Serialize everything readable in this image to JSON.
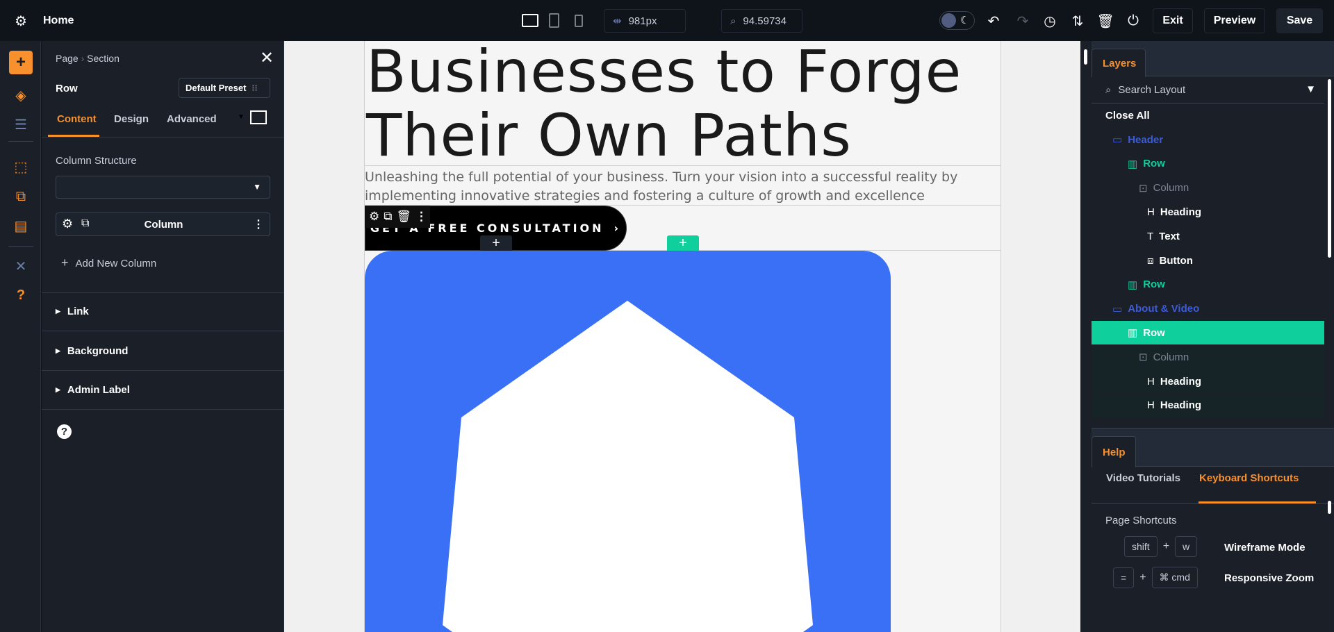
{
  "topbar": {
    "title": "Home",
    "width_value": "981px",
    "zoom_value": "94.59734",
    "exit": "Exit",
    "preview": "Preview",
    "save": "Save",
    "icons": [
      "gear-icon",
      "desktop-icon",
      "tablet-icon",
      "phone-icon",
      "width-icon",
      "zoom-icon",
      "dark-mode-toggle",
      "undo-icon",
      "redo-icon",
      "history-icon",
      "sort-icon",
      "trash-icon",
      "power-icon"
    ]
  },
  "rail": {
    "icons": [
      "add-icon",
      "layers-icon",
      "layout-icon",
      "select-icon",
      "multi-select-icon",
      "template-icon",
      "tools-icon",
      "help-icon"
    ],
    "accent": "#f7902d"
  },
  "settings": {
    "breadcrumb": [
      "Page",
      "Section"
    ],
    "title": "Row",
    "preset": "Default Preset",
    "tabs": [
      "Content",
      "Design",
      "Advanced"
    ],
    "active_tab": "Content",
    "column_structure_label": "Column Structure",
    "column_structure_value": "",
    "column_item": "Column",
    "add_column": "Add New Column",
    "sections": [
      "Link",
      "Background",
      "Admin Label"
    ]
  },
  "canvas": {
    "heading_line1": "Businesses to Forge",
    "heading_line2": "Their Own Paths",
    "paragraph_line1": "Unleashing the full potential of your business. Turn your vision into a successful reality by",
    "paragraph_line2": "implementing innovative strategies and fostering a culture of growth and excellence",
    "button": "GET A FREE CONSULTATION",
    "button_arrow": "›",
    "image_color": "#3a70f5"
  },
  "layers": {
    "tab": "Layers",
    "search_placeholder": "Search Layout",
    "close_all": "Close All",
    "items": [
      {
        "label": "Header",
        "type": "section",
        "depth": 1
      },
      {
        "label": "Row",
        "type": "row",
        "depth": 2
      },
      {
        "label": "Column",
        "type": "column",
        "depth": 3
      },
      {
        "label": "Heading",
        "type": "heading",
        "depth": 4
      },
      {
        "label": "Text",
        "type": "text",
        "depth": 4
      },
      {
        "label": "Button",
        "type": "button",
        "depth": 4
      },
      {
        "label": "Row",
        "type": "row",
        "depth": 2
      },
      {
        "label": "About & Video",
        "type": "section",
        "depth": 1
      },
      {
        "label": "Row",
        "type": "row",
        "depth": 2,
        "selected": true
      },
      {
        "label": "Column",
        "type": "column",
        "depth": 3
      },
      {
        "label": "Heading",
        "type": "heading",
        "depth": 4
      },
      {
        "label": "Heading",
        "type": "heading",
        "depth": 4
      }
    ]
  },
  "help": {
    "tab": "Help",
    "subtabs": [
      "Video Tutorials",
      "Keyboard Shortcuts"
    ],
    "active_subtab": "Keyboard Shortcuts",
    "section": "Page Shortcuts",
    "shortcuts": [
      {
        "keys": [
          "shift",
          "w"
        ],
        "label": "Wireframe Mode"
      },
      {
        "keys": [
          "=",
          "⌘ cmd"
        ],
        "label": "Responsive Zoom"
      }
    ]
  }
}
